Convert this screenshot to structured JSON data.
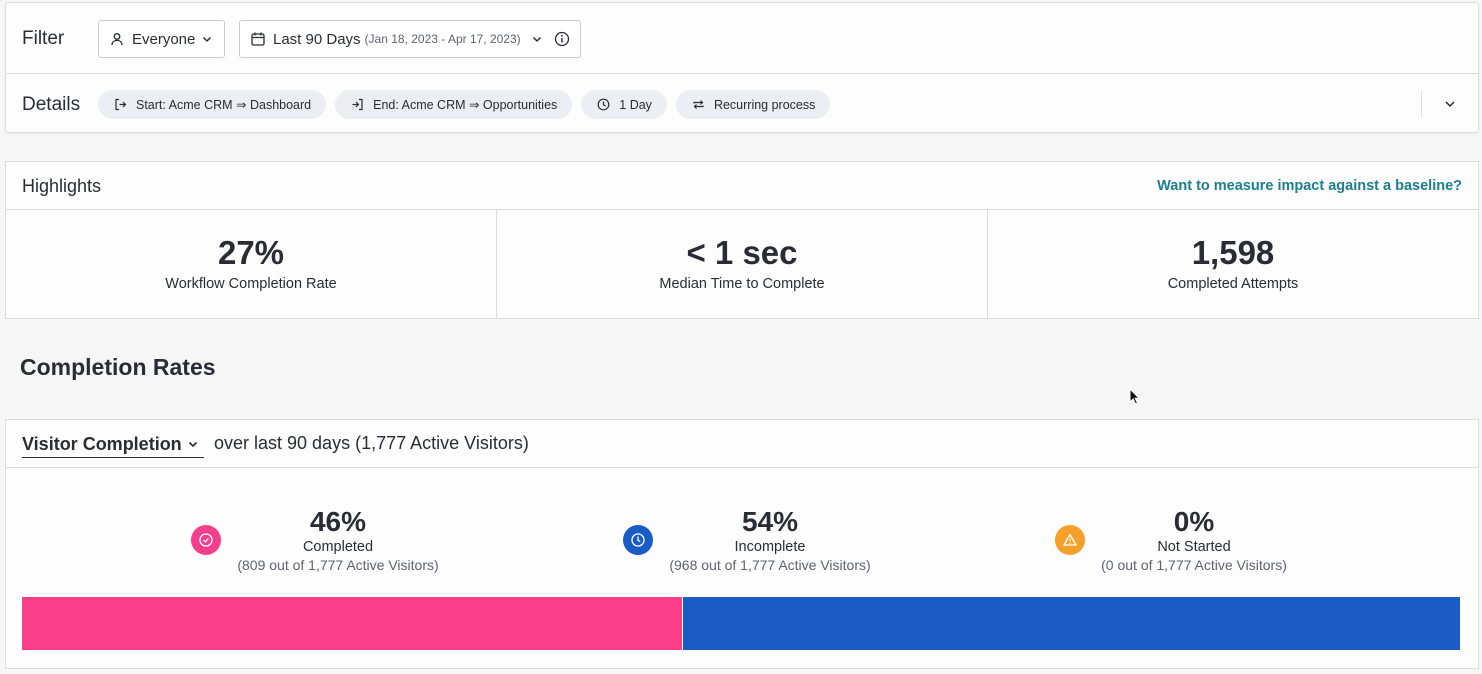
{
  "filter": {
    "label": "Filter",
    "segment": "Everyone",
    "date_range": "Last 90 Days",
    "date_sub": "(Jan 18, 2023 - Apr 17, 2023)"
  },
  "details": {
    "label": "Details",
    "chips": [
      {
        "label": "Start: Acme CRM ⇒ Dashboard",
        "icon": "start-icon"
      },
      {
        "label": "End: Acme CRM ⇒ Opportunities",
        "icon": "end-icon"
      },
      {
        "label": "1 Day",
        "icon": "clock-icon"
      },
      {
        "label": "Recurring process",
        "icon": "repeat-icon"
      }
    ]
  },
  "highlights": {
    "title": "Highlights",
    "link": "Want to measure impact against a baseline?",
    "metrics": [
      {
        "value": "27%",
        "label": "Workflow Completion Rate"
      },
      {
        "value": "< 1 sec",
        "label": "Median Time to Complete"
      },
      {
        "value": "1,598",
        "label": "Completed Attempts"
      }
    ]
  },
  "completion": {
    "section_title": "Completion Rates",
    "selector": "Visitor Completion",
    "description": "over last 90 days (1,777 Active Visitors)",
    "stats": [
      {
        "value": "46%",
        "label": "Completed",
        "sub": "(809 out of 1,777 Active Visitors)",
        "color": "#f43f8a",
        "icon": "check-circle-icon"
      },
      {
        "value": "54%",
        "label": "Incomplete",
        "sub": "(968 out of 1,777 Active Visitors)",
        "color": "#1a5bc4",
        "icon": "clock-icon"
      },
      {
        "value": "0%",
        "label": "Not Started",
        "sub": "(0 out of 1,777 Active Visitors)",
        "color": "#f4a02a",
        "icon": "warning-icon"
      }
    ],
    "bar": [
      {
        "name": "Completed",
        "percent": 46,
        "color": "#fd3e8a"
      },
      {
        "name": "Incomplete",
        "percent": 54,
        "color": "#1a5bc4"
      },
      {
        "name": "Not Started",
        "percent": 0,
        "color": "#f4a02a"
      }
    ]
  },
  "colors": {
    "accent_link": "#1b7f8f",
    "border": "#dadce5",
    "chip_bg": "#eceef3"
  }
}
